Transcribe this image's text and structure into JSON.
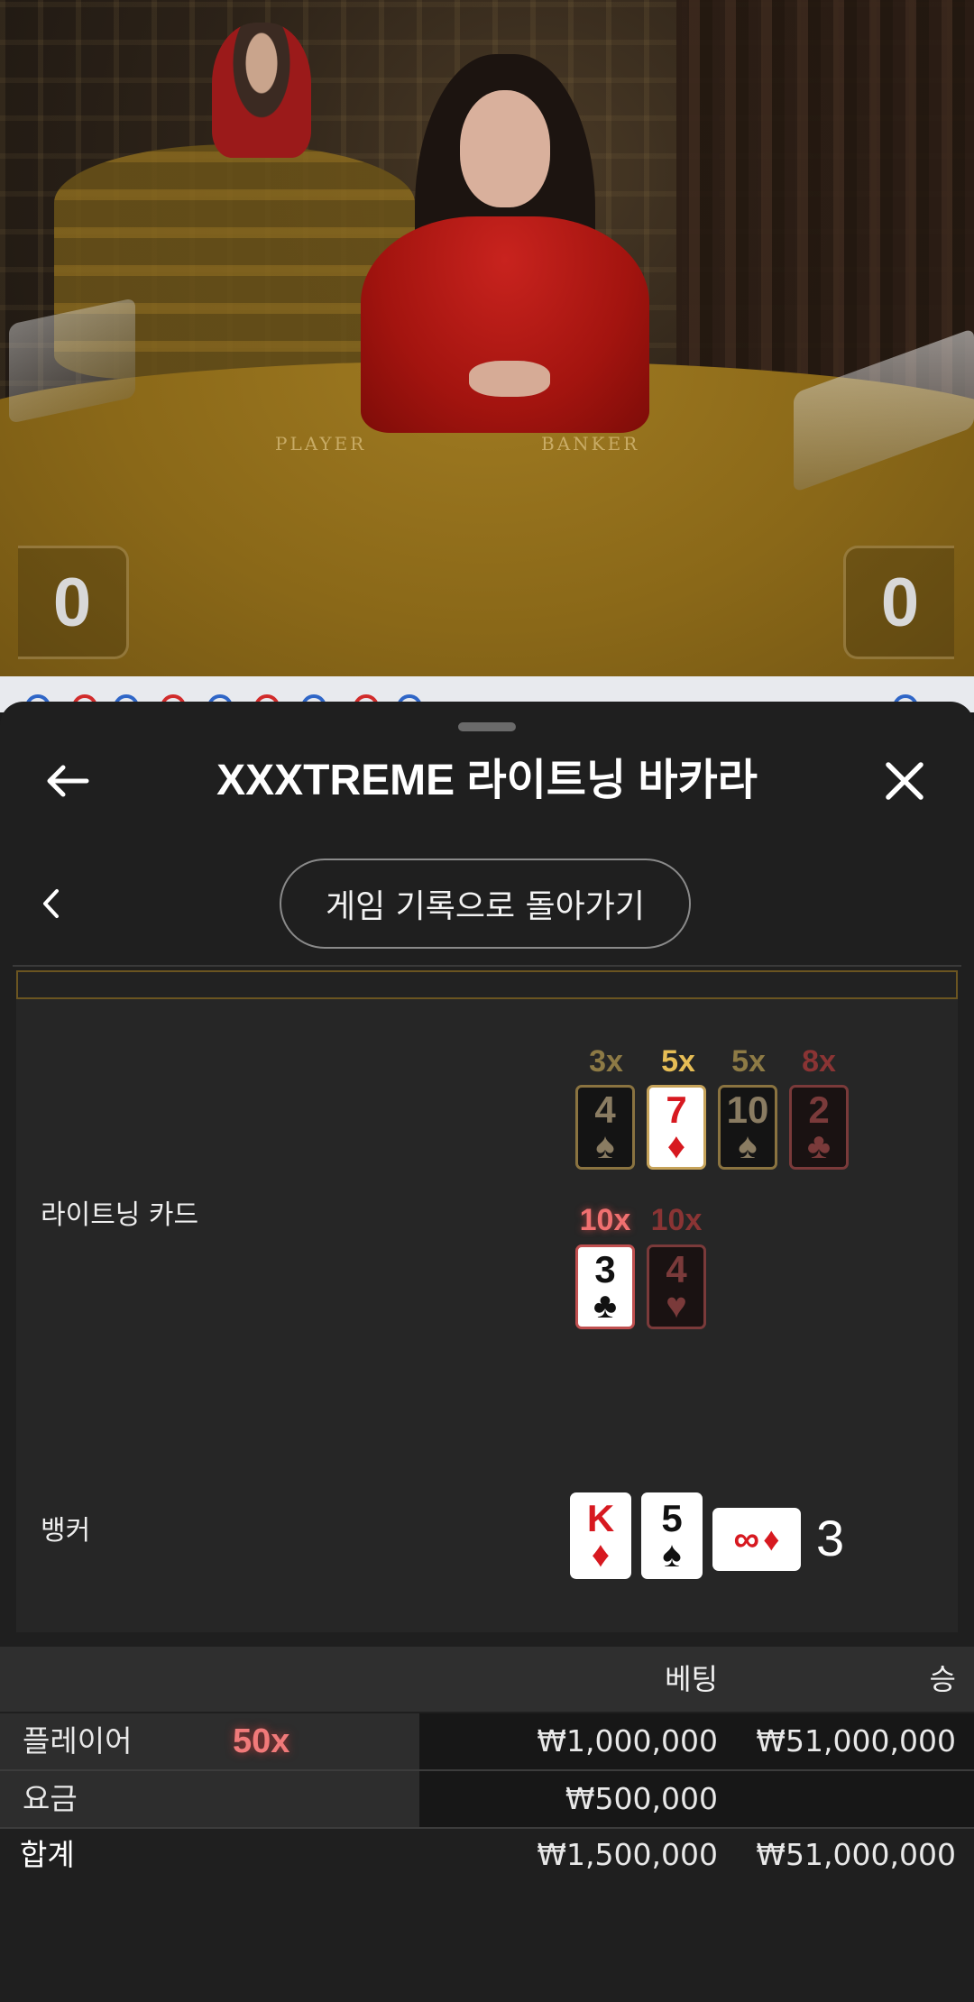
{
  "video": {
    "felt_player_label": "PLAYER",
    "felt_banker_label": "BANKER",
    "player_score": "0",
    "banker_score": "0"
  },
  "header": {
    "title": "XXXTREME 라이트닝 바카라",
    "back_icon": "arrow-left-icon",
    "close_icon": "close-x-icon"
  },
  "nav": {
    "history_button_label": "게임 기록으로 돌아가기",
    "prev_icon": "chevron-left-icon"
  },
  "result": {
    "lightning_label": "라이트닝 카드",
    "banker_label": "뱅커",
    "lightning_row1": [
      {
        "mult": "3x",
        "rank": "4",
        "suit": "♠",
        "style": "dark"
      },
      {
        "mult": "5x",
        "rank": "7",
        "suit": "♦",
        "style": "lit"
      },
      {
        "mult": "5x",
        "rank": "10",
        "suit": "♠",
        "style": "dark"
      },
      {
        "mult": "8x",
        "rank": "2",
        "suit": "♣",
        "style": "dark-red"
      }
    ],
    "lightning_row2": [
      {
        "mult": "10x",
        "rank": "3",
        "suit": "♣",
        "style": "lit-red-border"
      },
      {
        "mult": "10x",
        "rank": "4",
        "suit": "♥",
        "style": "dark-red"
      }
    ],
    "banker_cards": [
      {
        "rank": "K",
        "suit": "♦"
      },
      {
        "rank": "5",
        "suit": "♠"
      }
    ],
    "banker_side_card": {
      "symbol": "∞",
      "suit": "♦"
    },
    "banker_total": "3"
  },
  "bets": {
    "col_bet": "베팅",
    "col_win": "승",
    "rows": [
      {
        "label": "플레이어",
        "multiplier": "50x",
        "bet": "₩1,000,000",
        "win": "₩51,000,000"
      },
      {
        "label": "요금",
        "multiplier": "",
        "bet": "₩500,000",
        "win": ""
      }
    ],
    "total": {
      "label": "합계",
      "bet": "₩1,500,000",
      "win": "₩51,000,000"
    }
  }
}
